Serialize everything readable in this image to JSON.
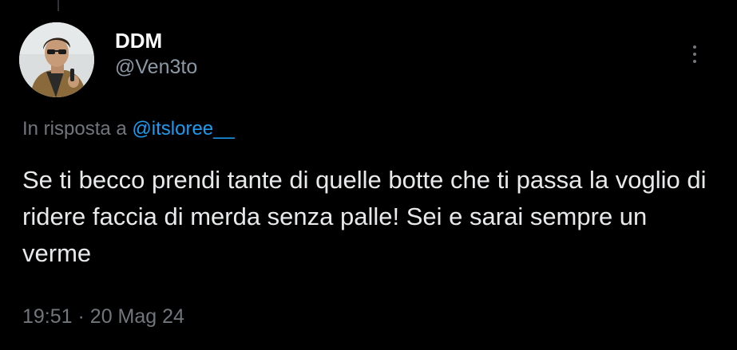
{
  "tweet": {
    "author": {
      "display_name": "DDM",
      "handle": "@Ven3to",
      "avatar_icon": "user-avatar-photo"
    },
    "more_icon": "more-vertical-icon",
    "reply": {
      "prefix": "In risposta a",
      "mention": "@itsloree__"
    },
    "text": "Se ti becco prendi tante di quelle botte che ti passa la voglio di ridere faccia di merda senza palle! Sei e sarai sempre un verme",
    "meta": {
      "time": "19:51",
      "separator": "·",
      "date": "20 Mag 24"
    }
  },
  "colors": {
    "background": "#000000",
    "primary_text": "#e7e9ea",
    "secondary_text": "#71767b",
    "accent": "#1d9bf0"
  }
}
